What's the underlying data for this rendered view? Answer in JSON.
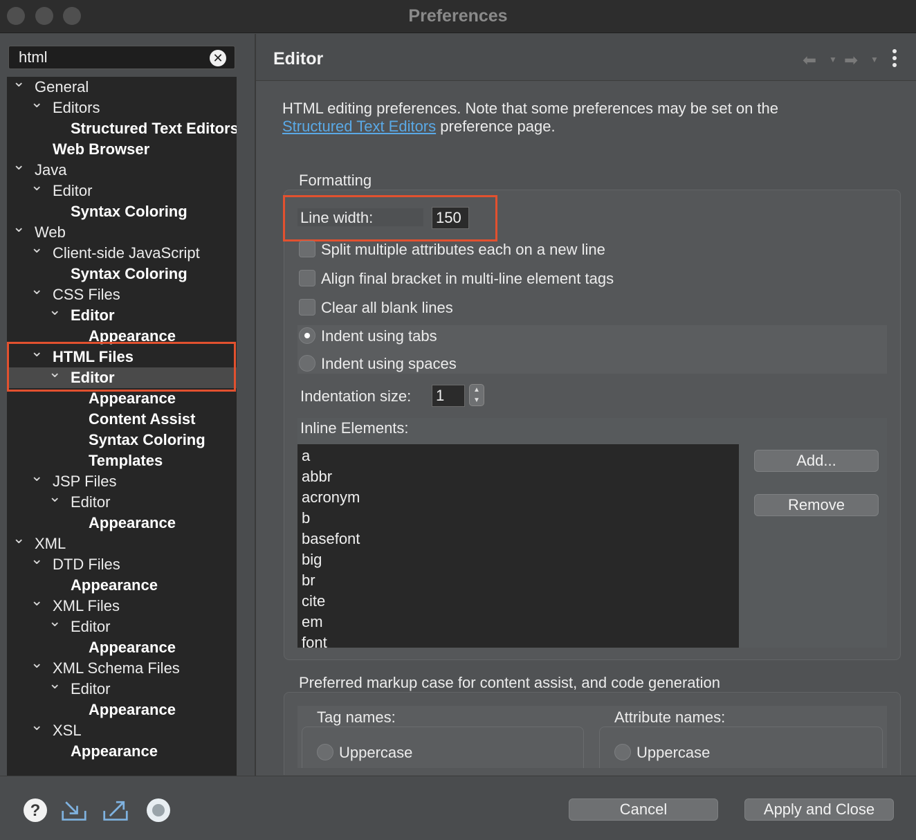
{
  "window": {
    "title": "Preferences"
  },
  "filter": {
    "value": "html"
  },
  "tree": [
    {
      "label": "General",
      "level": 0,
      "expanded": true,
      "bold": false
    },
    {
      "label": "Editors",
      "level": 1,
      "expanded": true,
      "bold": false
    },
    {
      "label": "Structured Text Editors",
      "level": 2,
      "expanded": null,
      "bold": true
    },
    {
      "label": "Web Browser",
      "level": 1,
      "expanded": null,
      "bold": true
    },
    {
      "label": "Java",
      "level": 0,
      "expanded": true,
      "bold": false
    },
    {
      "label": "Editor",
      "level": 1,
      "expanded": true,
      "bold": false
    },
    {
      "label": "Syntax Coloring",
      "level": 2,
      "expanded": null,
      "bold": true
    },
    {
      "label": "Web",
      "level": 0,
      "expanded": true,
      "bold": false
    },
    {
      "label": "Client-side JavaScript",
      "level": 1,
      "expanded": true,
      "bold": false
    },
    {
      "label": "Syntax Coloring",
      "level": 2,
      "expanded": null,
      "bold": true
    },
    {
      "label": "CSS Files",
      "level": 1,
      "expanded": true,
      "bold": false
    },
    {
      "label": "Editor",
      "level": 2,
      "expanded": true,
      "bold": true
    },
    {
      "label": "Appearance",
      "level": 3,
      "expanded": null,
      "bold": true
    },
    {
      "label": "HTML Files",
      "level": 1,
      "expanded": true,
      "bold": true
    },
    {
      "label": "Editor",
      "level": 2,
      "expanded": true,
      "bold": true,
      "selected": true
    },
    {
      "label": "Appearance",
      "level": 3,
      "expanded": null,
      "bold": true
    },
    {
      "label": "Content Assist",
      "level": 3,
      "expanded": null,
      "bold": true
    },
    {
      "label": "Syntax Coloring",
      "level": 3,
      "expanded": null,
      "bold": true
    },
    {
      "label": "Templates",
      "level": 3,
      "expanded": null,
      "bold": true
    },
    {
      "label": "JSP Files",
      "level": 1,
      "expanded": true,
      "bold": false
    },
    {
      "label": "Editor",
      "level": 2,
      "expanded": true,
      "bold": false
    },
    {
      "label": "Appearance",
      "level": 3,
      "expanded": null,
      "bold": true
    },
    {
      "label": "XML",
      "level": 0,
      "expanded": true,
      "bold": false
    },
    {
      "label": "DTD Files",
      "level": 1,
      "expanded": true,
      "bold": false
    },
    {
      "label": "Appearance",
      "level": 2,
      "expanded": null,
      "bold": true
    },
    {
      "label": "XML Files",
      "level": 1,
      "expanded": true,
      "bold": false
    },
    {
      "label": "Editor",
      "level": 2,
      "expanded": true,
      "bold": false
    },
    {
      "label": "Appearance",
      "level": 3,
      "expanded": null,
      "bold": true
    },
    {
      "label": "XML Schema Files",
      "level": 1,
      "expanded": true,
      "bold": false
    },
    {
      "label": "Editor",
      "level": 2,
      "expanded": true,
      "bold": false
    },
    {
      "label": "Appearance",
      "level": 3,
      "expanded": null,
      "bold": true
    },
    {
      "label": "XSL",
      "level": 1,
      "expanded": true,
      "bold": false
    },
    {
      "label": "Appearance",
      "level": 2,
      "expanded": null,
      "bold": true
    }
  ],
  "page": {
    "title": "Editor",
    "desc_prefix": "HTML editing preferences.  Note that some preferences may be set on the",
    "desc_link": "Structured Text Editors",
    "desc_suffix": "preference page."
  },
  "formatting": {
    "group_label": "Formatting",
    "line_width_label": "Line width:",
    "line_width_value": "150",
    "split_attrs": "Split multiple attributes each on a new line",
    "align_bracket": "Align final bracket in multi-line element tags",
    "clear_blank": "Clear all blank lines",
    "indent_tabs": "Indent using tabs",
    "indent_spaces": "Indent using spaces",
    "indent_size_label": "Indentation size:",
    "indent_size_value": "1",
    "inline_label": "Inline Elements:",
    "inline_elements": [
      "a",
      "abbr",
      "acronym",
      "b",
      "basefont",
      "big",
      "br",
      "cite",
      "em",
      "font"
    ],
    "add_button": "Add...",
    "remove_button": "Remove"
  },
  "markup_case": {
    "group_label": "Preferred markup case for content assist, and code generation",
    "tag_names_label": "Tag names:",
    "tag_upper": "Uppercase",
    "attr_names_label": "Attribute names:",
    "attr_upper": "Uppercase"
  },
  "footer": {
    "cancel": "Cancel",
    "apply_close": "Apply and Close"
  },
  "colors": {
    "highlight": "#e2512f",
    "link": "#5aa9e6"
  }
}
